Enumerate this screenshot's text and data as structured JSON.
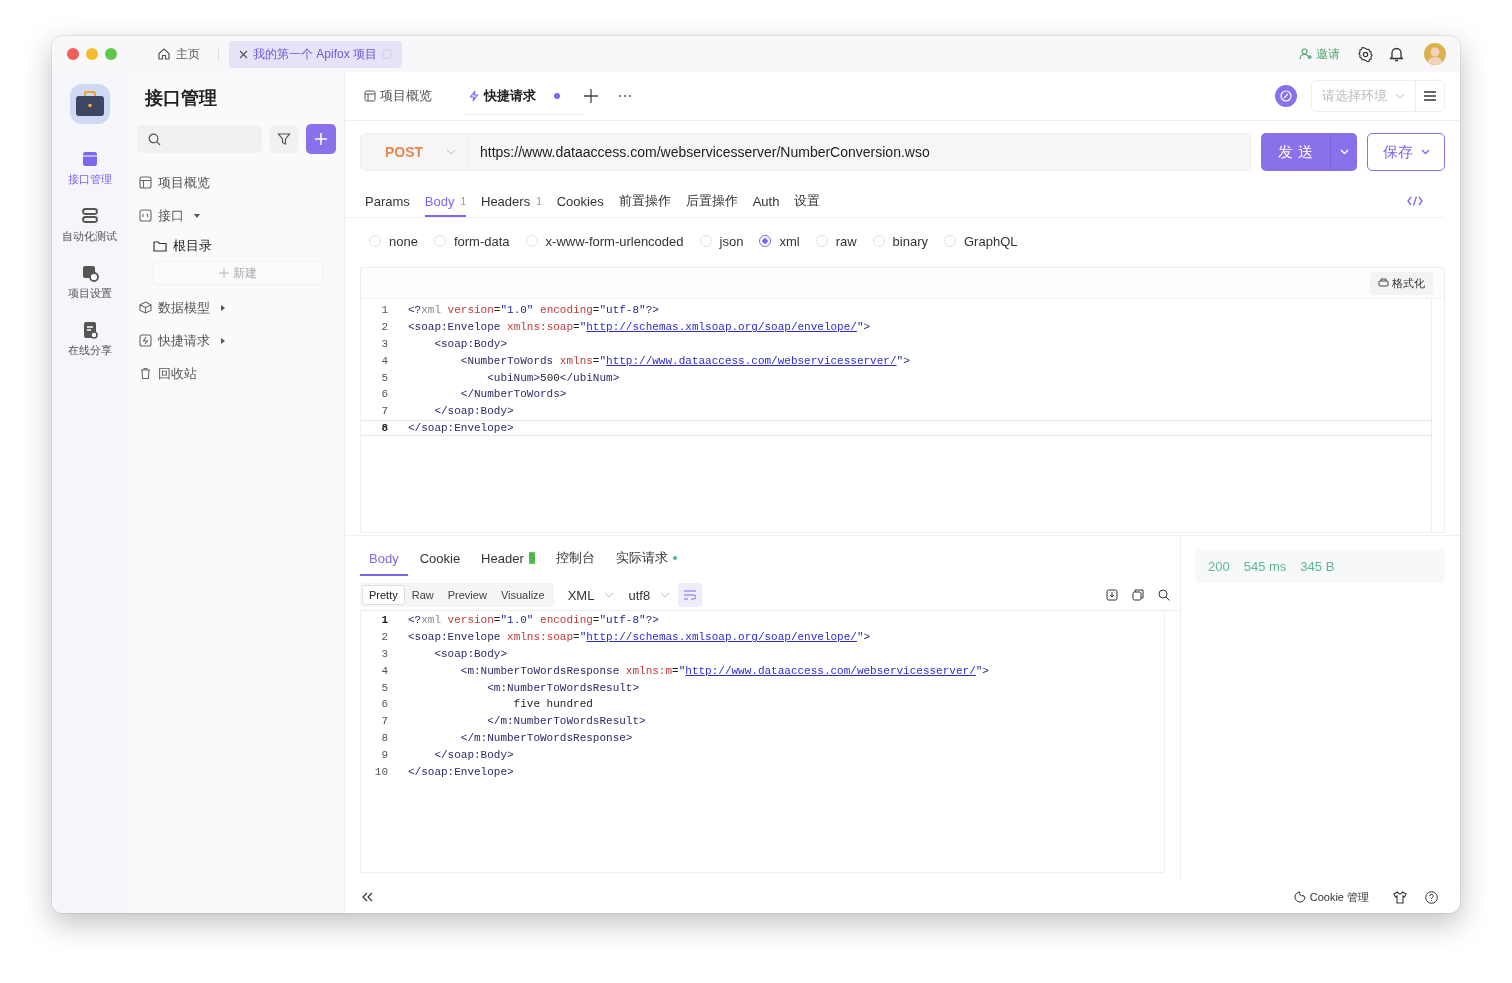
{
  "window_tabs": [
    {
      "label": "主页",
      "kind": "home",
      "selected": false
    },
    {
      "label": "我的第一个 Apifox 项目",
      "kind": "project",
      "selected": true
    }
  ],
  "header": {
    "invite": "邀请"
  },
  "nav": [
    {
      "label": "接口管理",
      "kind": "api",
      "selected": true
    },
    {
      "label": "自动化测试",
      "kind": "test",
      "selected": false
    },
    {
      "label": "项目设置",
      "kind": "settings",
      "selected": false
    },
    {
      "label": "在线分享",
      "kind": "share",
      "selected": false
    }
  ],
  "sidebar": {
    "title": "接口管理",
    "new_button": "新建",
    "items": [
      {
        "label": "项目概览",
        "kind": "overview"
      },
      {
        "label": "接口",
        "kind": "api",
        "expanded": true,
        "children": [
          {
            "label": "根目录",
            "kind": "folder"
          }
        ]
      },
      {
        "label": "数据模型",
        "kind": "model",
        "expanded": false
      },
      {
        "label": "快捷请求",
        "kind": "quick",
        "expanded": false
      },
      {
        "label": "回收站",
        "kind": "trash"
      }
    ]
  },
  "tabs": [
    {
      "label": "项目概览",
      "kind": "overview",
      "selected": false,
      "unsaved": false
    },
    {
      "label": "快捷请求",
      "kind": "quick",
      "selected": true,
      "unsaved": true
    }
  ],
  "environment": {
    "placeholder": "请选择环境"
  },
  "request": {
    "method": "POST",
    "url": "https://www.dataaccess.com/webservicesserver/NumberConversion.wso",
    "send": "发 送",
    "save": "保存"
  },
  "request_tabs": [
    {
      "label": "Params",
      "selected": false
    },
    {
      "label": "Body",
      "count": "1",
      "selected": true
    },
    {
      "label": "Headers",
      "count": "1",
      "selected": false
    },
    {
      "label": "Cookies",
      "selected": false
    },
    {
      "label": "前置操作",
      "selected": false
    },
    {
      "label": "后置操作",
      "selected": false
    },
    {
      "label": "Auth",
      "selected": false
    },
    {
      "label": "设置",
      "selected": false
    }
  ],
  "body_types": [
    {
      "label": "none",
      "selected": false
    },
    {
      "label": "form-data",
      "selected": false
    },
    {
      "label": "x-www-form-urlencoded",
      "selected": false
    },
    {
      "label": "json",
      "selected": false
    },
    {
      "label": "xml",
      "selected": true
    },
    {
      "label": "raw",
      "selected": false
    },
    {
      "label": "binary",
      "selected": false
    },
    {
      "label": "GraphQL",
      "selected": false
    }
  ],
  "format_button": "格式化",
  "request_code": [
    {
      "number": "1",
      "current": false,
      "tokens": [
        {
          "kind": "tag",
          "text": "<?"
        },
        {
          "kind": "meta",
          "text": "xml "
        },
        {
          "kind": "attr",
          "text": "version"
        },
        {
          "kind": "plain",
          "text": "="
        },
        {
          "kind": "string",
          "text": "\"1.0\" "
        },
        {
          "kind": "attr",
          "text": "encoding"
        },
        {
          "kind": "plain",
          "text": "="
        },
        {
          "kind": "string",
          "text": "\"utf-8\""
        },
        {
          "kind": "tag",
          "text": "?>"
        }
      ]
    },
    {
      "number": "2",
      "current": false,
      "tokens": [
        {
          "kind": "tag",
          "text": "<soap:Envelope "
        },
        {
          "kind": "attr",
          "text": "xmlns:soap"
        },
        {
          "kind": "plain",
          "text": "="
        },
        {
          "kind": "string",
          "text": "\""
        },
        {
          "kind": "link",
          "text": "http://schemas.xmlsoap.org/soap/envelope/"
        },
        {
          "kind": "string",
          "text": "\""
        },
        {
          "kind": "tag",
          "text": ">"
        }
      ]
    },
    {
      "number": "3",
      "current": false,
      "tokens": [
        {
          "kind": "tag",
          "text": "    <soap:Body>"
        }
      ]
    },
    {
      "number": "4",
      "current": false,
      "tokens": [
        {
          "kind": "tag",
          "text": "        <NumberToWords "
        },
        {
          "kind": "attr",
          "text": "xmlns"
        },
        {
          "kind": "plain",
          "text": "="
        },
        {
          "kind": "string",
          "text": "\""
        },
        {
          "kind": "link",
          "text": "http://www.dataaccess.com/webservicesserver/"
        },
        {
          "kind": "string",
          "text": "\""
        },
        {
          "kind": "tag",
          "text": ">"
        }
      ]
    },
    {
      "number": "5",
      "current": false,
      "tokens": [
        {
          "kind": "tag",
          "text": "            <ubiNum>"
        },
        {
          "kind": "plain",
          "text": "500"
        },
        {
          "kind": "tag",
          "text": "</ubiNum>"
        }
      ]
    },
    {
      "number": "6",
      "current": false,
      "tokens": [
        {
          "kind": "tag",
          "text": "        </NumberToWords>"
        }
      ]
    },
    {
      "number": "7",
      "current": false,
      "tokens": [
        {
          "kind": "tag",
          "text": "    </soap:Body>"
        }
      ]
    },
    {
      "number": "8",
      "current": true,
      "tokens": [
        {
          "kind": "tag",
          "text": "</soap:Envelope>"
        }
      ]
    }
  ],
  "response_tabs": [
    {
      "label": "Body",
      "selected": true,
      "dot": false
    },
    {
      "label": "Cookie",
      "selected": false,
      "dot": false
    },
    {
      "label": "Header",
      "count": "9",
      "selected": false,
      "dot": false
    },
    {
      "label": "控制台",
      "selected": false,
      "dot": false
    },
    {
      "label": "实际请求",
      "selected": false,
      "dot": true
    }
  ],
  "view_modes": [
    {
      "label": "Pretty",
      "selected": true
    },
    {
      "label": "Raw",
      "selected": false
    },
    {
      "label": "Preview",
      "selected": false
    },
    {
      "label": "Visualize",
      "selected": false
    }
  ],
  "response_format": "XML",
  "response_encoding": "utf8",
  "response_code": [
    {
      "number": "1",
      "current": true,
      "tokens": [
        {
          "kind": "tag",
          "text": "<?"
        },
        {
          "kind": "meta",
          "text": "xml "
        },
        {
          "kind": "attr",
          "text": "version"
        },
        {
          "kind": "plain",
          "text": "="
        },
        {
          "kind": "string",
          "text": "\"1.0\" "
        },
        {
          "kind": "attr",
          "text": "encoding"
        },
        {
          "kind": "plain",
          "text": "="
        },
        {
          "kind": "string",
          "text": "\"utf-8\""
        },
        {
          "kind": "tag",
          "text": "?>"
        }
      ]
    },
    {
      "number": "2",
      "current": false,
      "tokens": [
        {
          "kind": "tag",
          "text": "<soap:Envelope "
        },
        {
          "kind": "attr",
          "text": "xmlns:soap"
        },
        {
          "kind": "plain",
          "text": "="
        },
        {
          "kind": "string",
          "text": "\""
        },
        {
          "kind": "link",
          "text": "http://schemas.xmlsoap.org/soap/envelope/"
        },
        {
          "kind": "string",
          "text": "\""
        },
        {
          "kind": "tag",
          "text": ">"
        }
      ]
    },
    {
      "number": "3",
      "current": false,
      "tokens": [
        {
          "kind": "tag",
          "text": "    <soap:Body>"
        }
      ]
    },
    {
      "number": "4",
      "current": false,
      "tokens": [
        {
          "kind": "tag",
          "text": "        <m:NumberToWordsResponse "
        },
        {
          "kind": "attr",
          "text": "xmlns:m"
        },
        {
          "kind": "plain",
          "text": "="
        },
        {
          "kind": "string",
          "text": "\""
        },
        {
          "kind": "link",
          "text": "http://www.dataaccess.com/webservicesserver/"
        },
        {
          "kind": "string",
          "text": "\""
        },
        {
          "kind": "tag",
          "text": ">"
        }
      ]
    },
    {
      "number": "5",
      "current": false,
      "tokens": [
        {
          "kind": "tag",
          "text": "            <m:NumberToWordsResult>"
        }
      ]
    },
    {
      "number": "6",
      "current": false,
      "tokens": [
        {
          "kind": "plain",
          "text": "                five hundred"
        }
      ]
    },
    {
      "number": "7",
      "current": false,
      "tokens": [
        {
          "kind": "tag",
          "text": "            </m:NumberToWordsResult>"
        }
      ]
    },
    {
      "number": "8",
      "current": false,
      "tokens": [
        {
          "kind": "tag",
          "text": "        </m:NumberToWordsResponse>"
        }
      ]
    },
    {
      "number": "9",
      "current": false,
      "tokens": [
        {
          "kind": "tag",
          "text": "    </soap:Body>"
        }
      ]
    },
    {
      "number": "10",
      "current": false,
      "tokens": [
        {
          "kind": "tag",
          "text": "</soap:Envelope>"
        }
      ]
    }
  ],
  "response_status": {
    "code": "200",
    "time": "545 ms",
    "size": "345 B"
  },
  "footer": {
    "cookie_manager": "Cookie 管理"
  }
}
